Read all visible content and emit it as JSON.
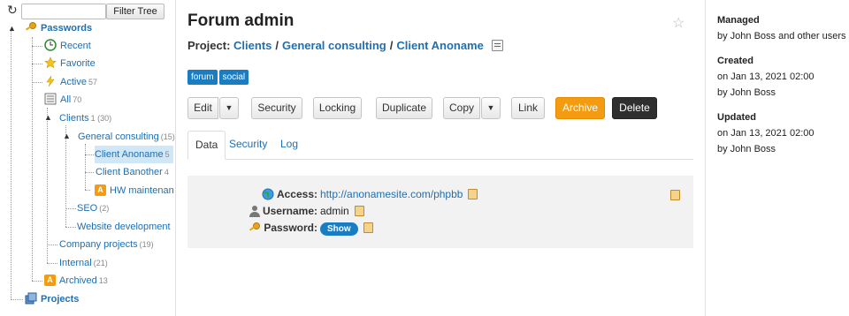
{
  "sidebar": {
    "filter_placeholder": "",
    "filter_button": "Filter Tree",
    "tree": {
      "passwords": "Passwords",
      "recent": "Recent",
      "favorite": "Favorite",
      "active": "Active",
      "active_count": "57",
      "all": "All",
      "all_count": "70",
      "clients": "Clients",
      "clients_count": "1 (30)",
      "general_consulting": "General consulting",
      "general_consulting_count": "(15)",
      "client_anoname": "Client Anoname",
      "client_anoname_count": "5",
      "client_banother": "Client Banother",
      "client_banother_count": "4",
      "hw_maintenance": "HW maintenan",
      "seo": "SEO",
      "seo_count": "(2)",
      "website_development": "Website development",
      "company_projects": "Company projects",
      "company_projects_count": "(19)",
      "internal": "Internal",
      "internal_count": "(21)",
      "archived": "Archived",
      "archived_count": "13",
      "projects": "Projects"
    }
  },
  "main": {
    "title": "Forum admin",
    "project_prefix": "Project:",
    "breadcrumb": [
      "Clients",
      "General consulting",
      "Client Anoname"
    ],
    "breadcrumb_sep": "/",
    "tags": [
      "forum",
      "social"
    ],
    "toolbar": {
      "edit": "Edit",
      "security": "Security",
      "locking": "Locking",
      "duplicate": "Duplicate",
      "copy": "Copy",
      "link": "Link",
      "archive": "Archive",
      "delete": "Delete",
      "caret": "▼"
    },
    "tabs": [
      "Data",
      "Security",
      "Log"
    ],
    "fields": {
      "access_label": "Access:",
      "access_value": "http://anonamesite.com/phpbb",
      "username_label": "Username:",
      "username_value": "admin",
      "password_label": "Password:",
      "password_button": "Show"
    }
  },
  "info": {
    "managed_title": "Managed",
    "managed_text": "by John Boss and other users",
    "created_title": "Created",
    "created_on": "on Jan 13, 2021 02:00",
    "created_by": "by John Boss",
    "updated_title": "Updated",
    "updated_on": "on Jan 13, 2021 02:00",
    "updated_by": "by John Boss"
  }
}
